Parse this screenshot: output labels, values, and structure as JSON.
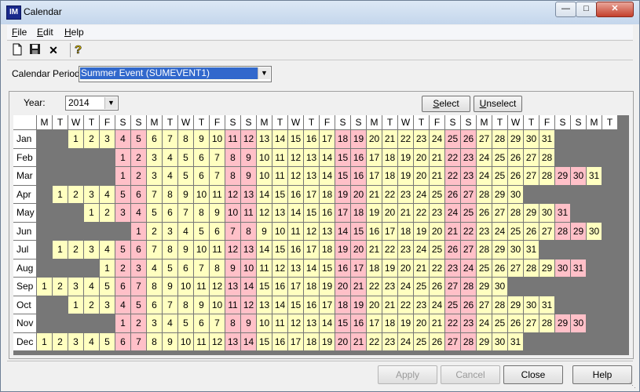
{
  "window": {
    "title": "Calendar",
    "icon_text": "IM"
  },
  "menu": [
    {
      "label": "File",
      "key": "F",
      "rest": "ile"
    },
    {
      "label": "Edit",
      "key": "E",
      "rest": "dit"
    },
    {
      "label": "Help",
      "key": "H",
      "rest": "elp"
    }
  ],
  "toolbar": {
    "icons": [
      "new-document-icon",
      "save-icon",
      "delete-x-icon",
      "help-icon"
    ]
  },
  "period": {
    "label": "Calendar Period:",
    "value": "Summer Event (SUMEVENT1)"
  },
  "year": {
    "label": "Year:",
    "value": "2014"
  },
  "select_button": {
    "label": "Select",
    "key": "S",
    "rest": "elect"
  },
  "unselect_button": {
    "label": "Unselect",
    "key": "U",
    "rest": "nselect"
  },
  "calendar": {
    "weekday_headers": [
      "M",
      "T",
      "W",
      "T",
      "F",
      "S",
      "S",
      "M",
      "T",
      "W",
      "T",
      "F",
      "S",
      "S",
      "M",
      "T",
      "W",
      "T",
      "F",
      "S",
      "S",
      "M",
      "T",
      "W",
      "T",
      "F",
      "S",
      "S",
      "M",
      "T",
      "W",
      "T",
      "F",
      "S",
      "S",
      "M",
      "T"
    ],
    "months": [
      {
        "name": "Jan",
        "start": 2,
        "days": 31
      },
      {
        "name": "Feb",
        "start": 5,
        "days": 28
      },
      {
        "name": "Mar",
        "start": 5,
        "days": 31
      },
      {
        "name": "Apr",
        "start": 1,
        "days": 30
      },
      {
        "name": "May",
        "start": 3,
        "days": 31
      },
      {
        "name": "Jun",
        "start": 6,
        "days": 30
      },
      {
        "name": "Jul",
        "start": 1,
        "days": 31
      },
      {
        "name": "Aug",
        "start": 4,
        "days": 31
      },
      {
        "name": "Sep",
        "start": 0,
        "days": 30
      },
      {
        "name": "Oct",
        "start": 2,
        "days": 31
      },
      {
        "name": "Nov",
        "start": 5,
        "days": 30
      },
      {
        "name": "Dec",
        "start": 0,
        "days": 31
      }
    ]
  },
  "colors": {
    "weekday": "#ffffc0",
    "weekend": "#ffc0c8",
    "empty": "#777777"
  },
  "buttons": {
    "apply": "Apply",
    "cancel": "Cancel",
    "close": "Close",
    "help": "Help"
  }
}
